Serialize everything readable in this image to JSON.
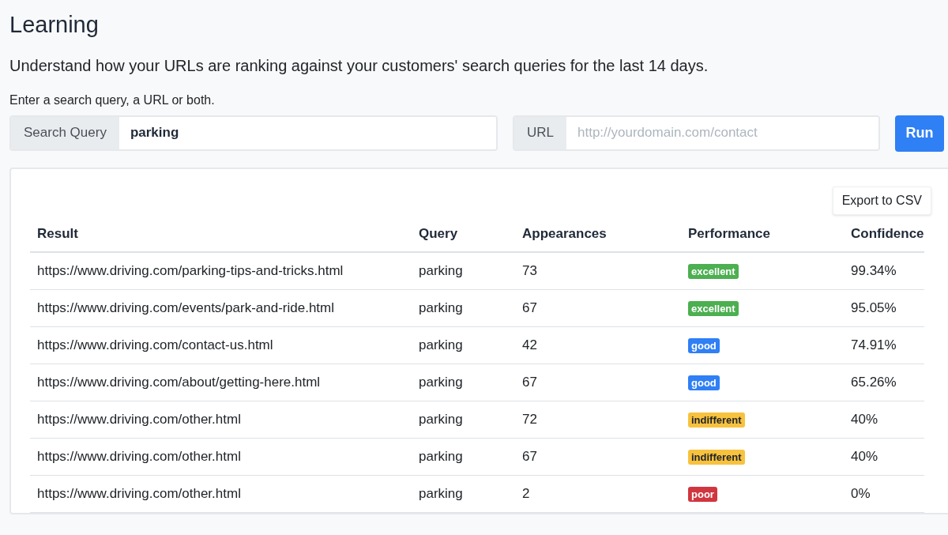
{
  "title": "Learning",
  "subtitle": "Understand how your URLs are ranking against your customers' search queries for the last 14 days.",
  "instruction": "Enter a search query, a URL or both.",
  "fields": [
    {
      "label": "Search Query",
      "value": "parking"
    },
    {
      "label": "URL",
      "placeholder": "http://yourdomain.com/contact"
    }
  ],
  "run_button": "Run",
  "export_button": "Export to CSV",
  "table": {
    "columns": [
      "Result",
      "Query",
      "Appearances",
      "Performance",
      "Confidence"
    ],
    "rows": [
      {
        "result": "https://www.driving.com/parking-tips-and-tricks.html",
        "query": "parking",
        "appearances": "73",
        "performance": "excellent",
        "color": "#4caf50",
        "confidence": "99.34%"
      },
      {
        "result": "https://www.driving.com/events/park-and-ride.html",
        "query": "parking",
        "appearances": "67",
        "performance": "excellent",
        "color": "#4caf50",
        "confidence": "95.05%"
      },
      {
        "result": "https://www.driving.com/contact-us.html",
        "query": "parking",
        "appearances": "42",
        "performance": "good",
        "color": "#2f7ff5",
        "confidence": "74.91%"
      },
      {
        "result": "https://www.driving.com/about/getting-here.html",
        "query": "parking",
        "appearances": "67",
        "performance": "good",
        "color": "#2f7ff5",
        "confidence": "65.26%"
      },
      {
        "result": "https://www.driving.com/other.html",
        "query": "parking",
        "appearances": "72",
        "performance": "indifferent",
        "color": "#f7c23e",
        "confidence": "40%"
      },
      {
        "result": "https://www.driving.com/other.html",
        "query": "parking",
        "appearances": "67",
        "performance": "indifferent",
        "color": "#f7c23e",
        "confidence": "40%"
      },
      {
        "result": "https://www.driving.com/other.html",
        "query": "parking",
        "appearances": "2",
        "performance": "poor",
        "color": "#d0363f",
        "confidence": "0%"
      }
    ]
  }
}
